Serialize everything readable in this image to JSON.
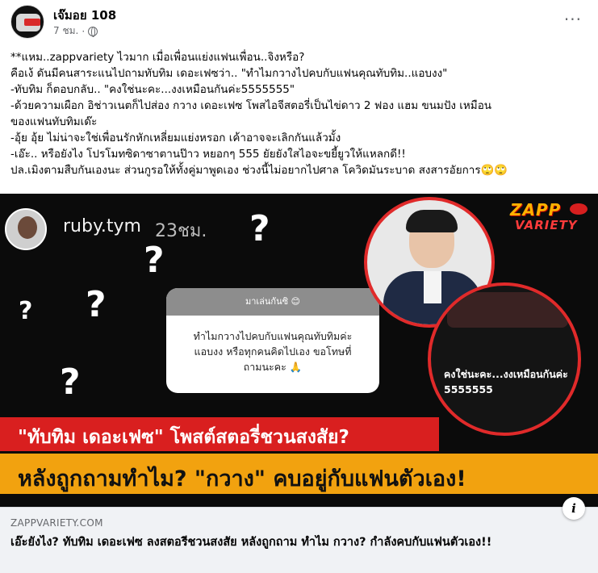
{
  "post": {
    "author": "เจ๊มอย 108",
    "time": "7 ชม.",
    "more_icon": "more-horizontal-icon",
    "privacy_icon": "globe-icon",
    "lines": [
      "**แหม..zappvariety ไวมาก เมื่อเพื่อนแย่งแฟนเพื่อน..จิงหรือ?",
      "คือเง้ ดันมีคนสาระแนไปถามทับทิม เดอะเฟซว่า.. \"ทำไมกวางไปคบกับแฟนคุณทับทิม..แอบงง\"",
      "-ทับทิม ก็ตอบกลับ.. \"คงใช่นะคะ...งงเหมือนกันค่ะ5555555\"",
      "-ด้วยความเผือก อิช่าวเนตก็ไปส่อง กวาง เดอะเฟซ โพสไอจีสตอรี่เป็นไข่ดาว 2 ฟอง แฮม ขนมปัง เหมือน",
      "ของแฟนทับทิมเด๊ะ",
      "-อุ้ย อุ้ย ไม่น่าจะใช่เพื่อนรักหักเหลี่ยมแย่งหรอก เค้าอาจจะเลิกกันแล้วมั้ง",
      "-เอ๊ะ.. หรือยังไง โปรโมทซิดาซาตานป๊าว หยอกๆ 555 ยัยยังใสไอจะขยี้ยูวให้แหลกดี!!",
      "ปล.เมิงตามสืบกันเองนะ ส่วนกูรอให้ทั้งคู่มาพูดเอง ช่วงนี้ไม่อยากไปศาล โควิดมันระบาด สงสารอัยการ🙄🙄"
    ]
  },
  "media": {
    "story_username": "ruby.tym",
    "story_time": "23ชม.",
    "question_marks": [
      "?",
      "?",
      "?",
      "?",
      "?"
    ],
    "card_header": "มาเล่นกันซิ 😊",
    "card_question": [
      "ทำไมกวางไปคบกับแฟนคุณทับทิมค่ะ",
      "แอบงง หรือทุกคนคิดไปเอง ขอโทษที่",
      "ถามนะคะ 🙏"
    ],
    "reply_lines": [
      "คงใช่นะคะ...งงเหมือนกันค่ะ",
      "5555555"
    ],
    "logo_main": "ZAPP",
    "logo_sub": "VARIETY",
    "banner_red": "\"ทับทิม เดอะเฟซ\" โพสต์สตอรี่ชวนสงสัย?",
    "banner_orange": "หลังถูกถามทำไม? \"กวาง\" คบอยู่กับแฟนตัวเอง!",
    "colors": {
      "banner_red": "#d91f1f",
      "banner_orange": "#f2a20f",
      "circle_border": "#e02a2a"
    }
  },
  "link_preview": {
    "domain": "ZAPPVARIETY.COM",
    "title": "เอ๊ะยังไง? ทับทิม เดอะเฟซ ลงสตอรีชวนสงสัย หลังถูกถาม ทำไม กวาง? กำลังคบกับแฟนตัวเอง!!",
    "info_icon": "info-icon",
    "info_label": "i"
  }
}
